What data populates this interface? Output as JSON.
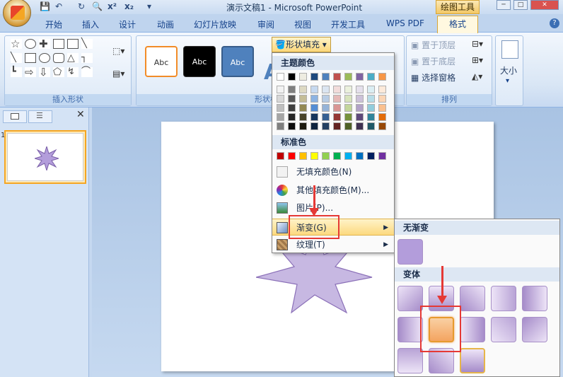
{
  "window": {
    "title": "演示文稿1 - Microsoft PowerPoint",
    "context_tab_title": "绘图工具",
    "minimize": "─",
    "maximize": "□",
    "close": "✕"
  },
  "quick_access": {
    "undo": "↶",
    "redo": "↻",
    "superscript": "x²",
    "subscript": "x₂"
  },
  "tabs": [
    "开始",
    "插入",
    "设计",
    "动画",
    "幻灯片放映",
    "审阅",
    "视图",
    "开发工具",
    "WPS PDF",
    "格式"
  ],
  "active_tab": "格式",
  "help": "?",
  "ribbon": {
    "insert_shapes_label": "插入形状",
    "shape_styles_label": "形状样式",
    "arrange_label": "排列",
    "style_samples": [
      "Abc",
      "Abc",
      "Abc"
    ],
    "fill_button": "形状填充",
    "bring_front": "置于顶层",
    "send_back": "置于底层",
    "selection_pane": "选择窗格",
    "size_label": "大小"
  },
  "dropdown": {
    "theme_colors_label": "主题颜色",
    "standard_colors_label": "标准色",
    "no_fill": "无填充颜色(N)",
    "more_colors": "其他填充颜色(M)...",
    "picture": "图片(P)...",
    "gradient": "渐变(G)",
    "texture": "纹理(T)",
    "theme_top_row": [
      "#ffffff",
      "#000000",
      "#eeece1",
      "#1f497d",
      "#4f81bd",
      "#c0504d",
      "#9bbb59",
      "#8064a2",
      "#4bacc6",
      "#f79646"
    ],
    "theme_shades": [
      [
        "#f2f2f2",
        "#7f7f7f",
        "#ddd9c3",
        "#c6d9f0",
        "#dbe5f1",
        "#f2dcdb",
        "#ebf1dd",
        "#e5e0ec",
        "#dbeef3",
        "#fdeada"
      ],
      [
        "#d8d8d8",
        "#595959",
        "#c4bd97",
        "#8db3e2",
        "#b8cce4",
        "#e5b9b7",
        "#d7e3bc",
        "#ccc1d9",
        "#b7dde8",
        "#fbd5b5"
      ],
      [
        "#bfbfbf",
        "#3f3f3f",
        "#938953",
        "#548dd4",
        "#95b3d7",
        "#d99694",
        "#c3d69b",
        "#b2a2c7",
        "#92cddc",
        "#fac08f"
      ],
      [
        "#a5a5a5",
        "#262626",
        "#494429",
        "#17365d",
        "#366092",
        "#953734",
        "#76923c",
        "#5f497a",
        "#31859b",
        "#e36c09"
      ],
      [
        "#7f7f7f",
        "#0c0c0c",
        "#1d1b10",
        "#0f243e",
        "#244061",
        "#632423",
        "#4f6128",
        "#3f3151",
        "#205867",
        "#974806"
      ]
    ],
    "standard": [
      "#c00000",
      "#ff0000",
      "#ffc000",
      "#ffff00",
      "#92d050",
      "#00b050",
      "#00b0f0",
      "#0070c0",
      "#002060",
      "#7030a0"
    ]
  },
  "submenu": {
    "no_gradient_label": "无渐变",
    "variants_label": "变体",
    "accent_color": "#f4a460",
    "tile_color": "#b39ddb"
  },
  "slide_panel": {
    "slide_number": "1",
    "close": "✕"
  },
  "shape_color": "#b39ddb"
}
